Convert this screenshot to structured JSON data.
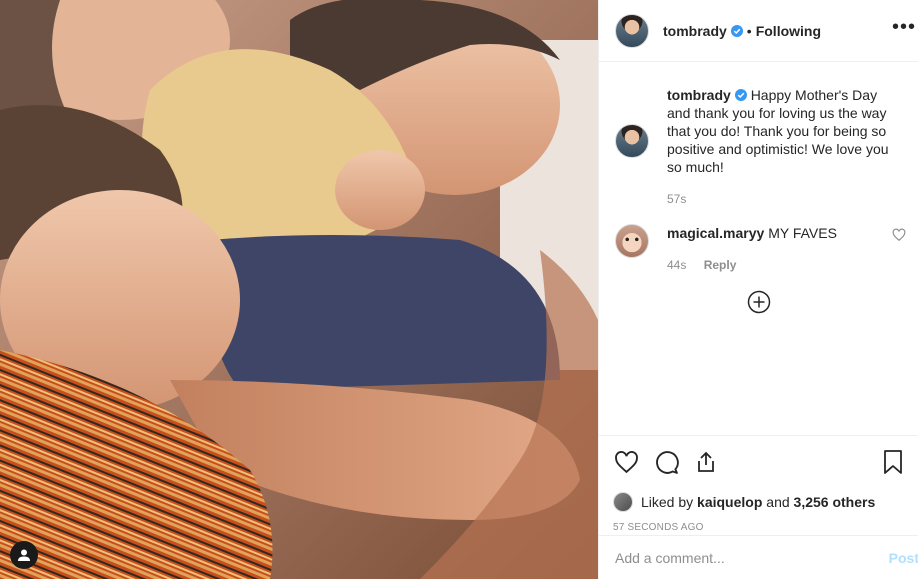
{
  "header": {
    "username": "tombrady",
    "separator": "•",
    "follow_status": "Following",
    "more_icon": "more-horizontal-icon"
  },
  "caption": {
    "username": "tombrady",
    "text": "Happy Mother's Day and thank you for loving us the way that you do! Thank you for being so positive and optimistic! We love you so much!",
    "time": "57s"
  },
  "comments": [
    {
      "username": "magical.maryy",
      "text": "MY FAVES",
      "time": "44s",
      "reply_label": "Reply"
    }
  ],
  "actions": {
    "like_icon": "heart-icon",
    "comment_icon": "comment-icon",
    "share_icon": "share-icon",
    "save_icon": "bookmark-icon"
  },
  "likes": {
    "prefix": "Liked by",
    "user": "kaiquelop",
    "and": "and",
    "count": "3,256 others"
  },
  "timestamp": "57 SECONDS AGO",
  "add_comment": {
    "placeholder": "Add a comment...",
    "post_label": "Post"
  },
  "colors": {
    "verified": "#3897f0",
    "post_disabled": "#b2dffc",
    "muted": "#8e8e8e"
  }
}
